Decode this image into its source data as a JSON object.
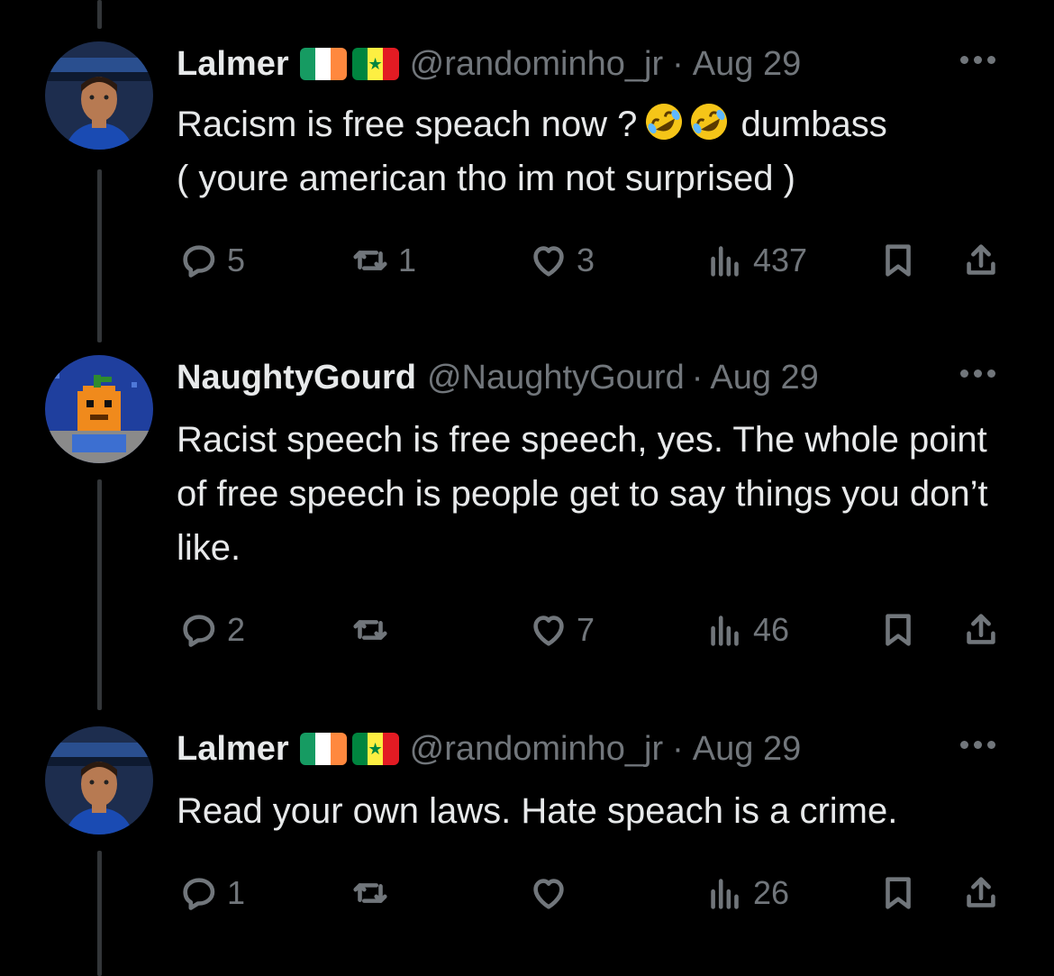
{
  "tweets": [
    {
      "name": "Lalmer",
      "handle": "@randominho_jr",
      "separator": "·",
      "date": "Aug 29",
      "text": "Racism is free speach now ? 🤣🤣 dumbass ( youre american tho im not surprised )",
      "text_line1_prefix": "Racism is free speach now ?",
      "text_line1_suffix": "dumbass",
      "text_line2": "( youre american tho im not surprised )",
      "stats": {
        "replies": "5",
        "reposts": "1",
        "likes": "3",
        "views": "437"
      }
    },
    {
      "name": "NaughtyGourd",
      "handle": "@NaughtyGourd",
      "separator": "·",
      "date": "Aug 29",
      "text": "Racist speech is free speech, yes. The whole point of free speech is people get to say things you don’t like.",
      "stats": {
        "replies": "2",
        "reposts": "",
        "likes": "7",
        "views": "46"
      }
    },
    {
      "name": "Lalmer",
      "handle": "@randominho_jr",
      "separator": "·",
      "date": "Aug 29",
      "text": "Read your own laws. Hate speach is a crime.",
      "stats": {
        "replies": "1",
        "reposts": "",
        "likes": "",
        "views": "26"
      }
    }
  ],
  "icons": {
    "reply": "speech-bubble-icon",
    "repost": "repost-arrows-icon",
    "like": "heart-icon",
    "views": "bar-chart-icon",
    "bookmark": "bookmark-icon",
    "share": "share-upload-icon",
    "more": "more-dots-icon",
    "emoji": "rolling-on-floor-laughing-emoji",
    "flags": [
      "ireland-flag-icon",
      "senegal-flag-icon"
    ]
  },
  "colors": {
    "background": "#000000",
    "text": "#e7e9ea",
    "muted": "#71767b",
    "thread_line": "#333639"
  }
}
